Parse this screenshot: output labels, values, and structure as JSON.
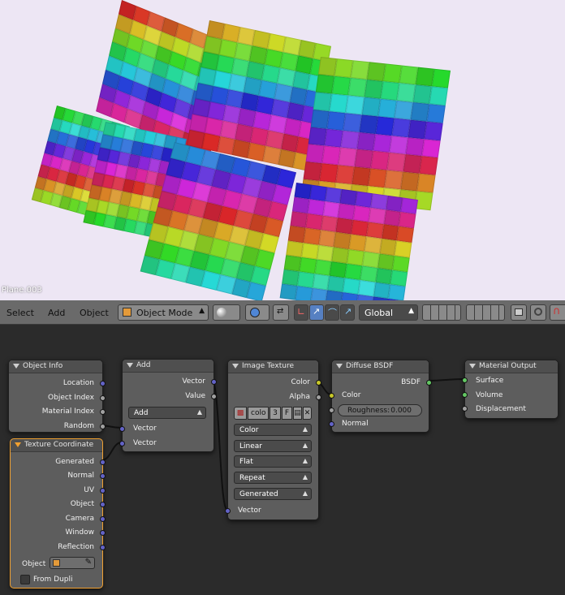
{
  "viewport": {
    "object_name": "Plane.003"
  },
  "header": {
    "menu": [
      "Select",
      "Add",
      "Object"
    ],
    "mode": "Object Mode",
    "orientation": "Global"
  },
  "nodes": {
    "object_info": {
      "title": "Object Info",
      "outputs": [
        "Location",
        "Object Index",
        "Material Index",
        "Random"
      ]
    },
    "texture_coordinate": {
      "title": "Texture Coordinate",
      "outputs": [
        "Generated",
        "Normal",
        "UV",
        "Object",
        "Camera",
        "Window",
        "Reflection"
      ],
      "object_label": "Object",
      "from_dupli": "From Dupli"
    },
    "add": {
      "title": "Add",
      "outputs": [
        "Vector",
        "Value"
      ],
      "operation": "Add",
      "inputs": [
        "Vector",
        "Vector"
      ]
    },
    "image_texture": {
      "title": "Image Texture",
      "outputs": [
        "Color",
        "Alpha"
      ],
      "image_name": "colo",
      "users": "3",
      "fake_user": "F",
      "color_space": "Color",
      "interpolation": "Linear",
      "projection": "Flat",
      "extension": "Repeat",
      "source": "Generated",
      "input": "Vector"
    },
    "diffuse": {
      "title": "Diffuse BSDF",
      "output": "BSDF",
      "inputs": [
        "Color",
        "Normal"
      ],
      "roughness_label": "Roughness:",
      "roughness_value": "0.000"
    },
    "material_output": {
      "title": "Material Output",
      "inputs": [
        "Surface",
        "Volume",
        "Displacement"
      ]
    }
  },
  "colors": {
    "vector_socket": "#6363c7",
    "value_socket": "#a1a1a1",
    "color_socket": "#c7c729",
    "shader_socket": "#63c763",
    "selected_outline": "#f0a030"
  }
}
